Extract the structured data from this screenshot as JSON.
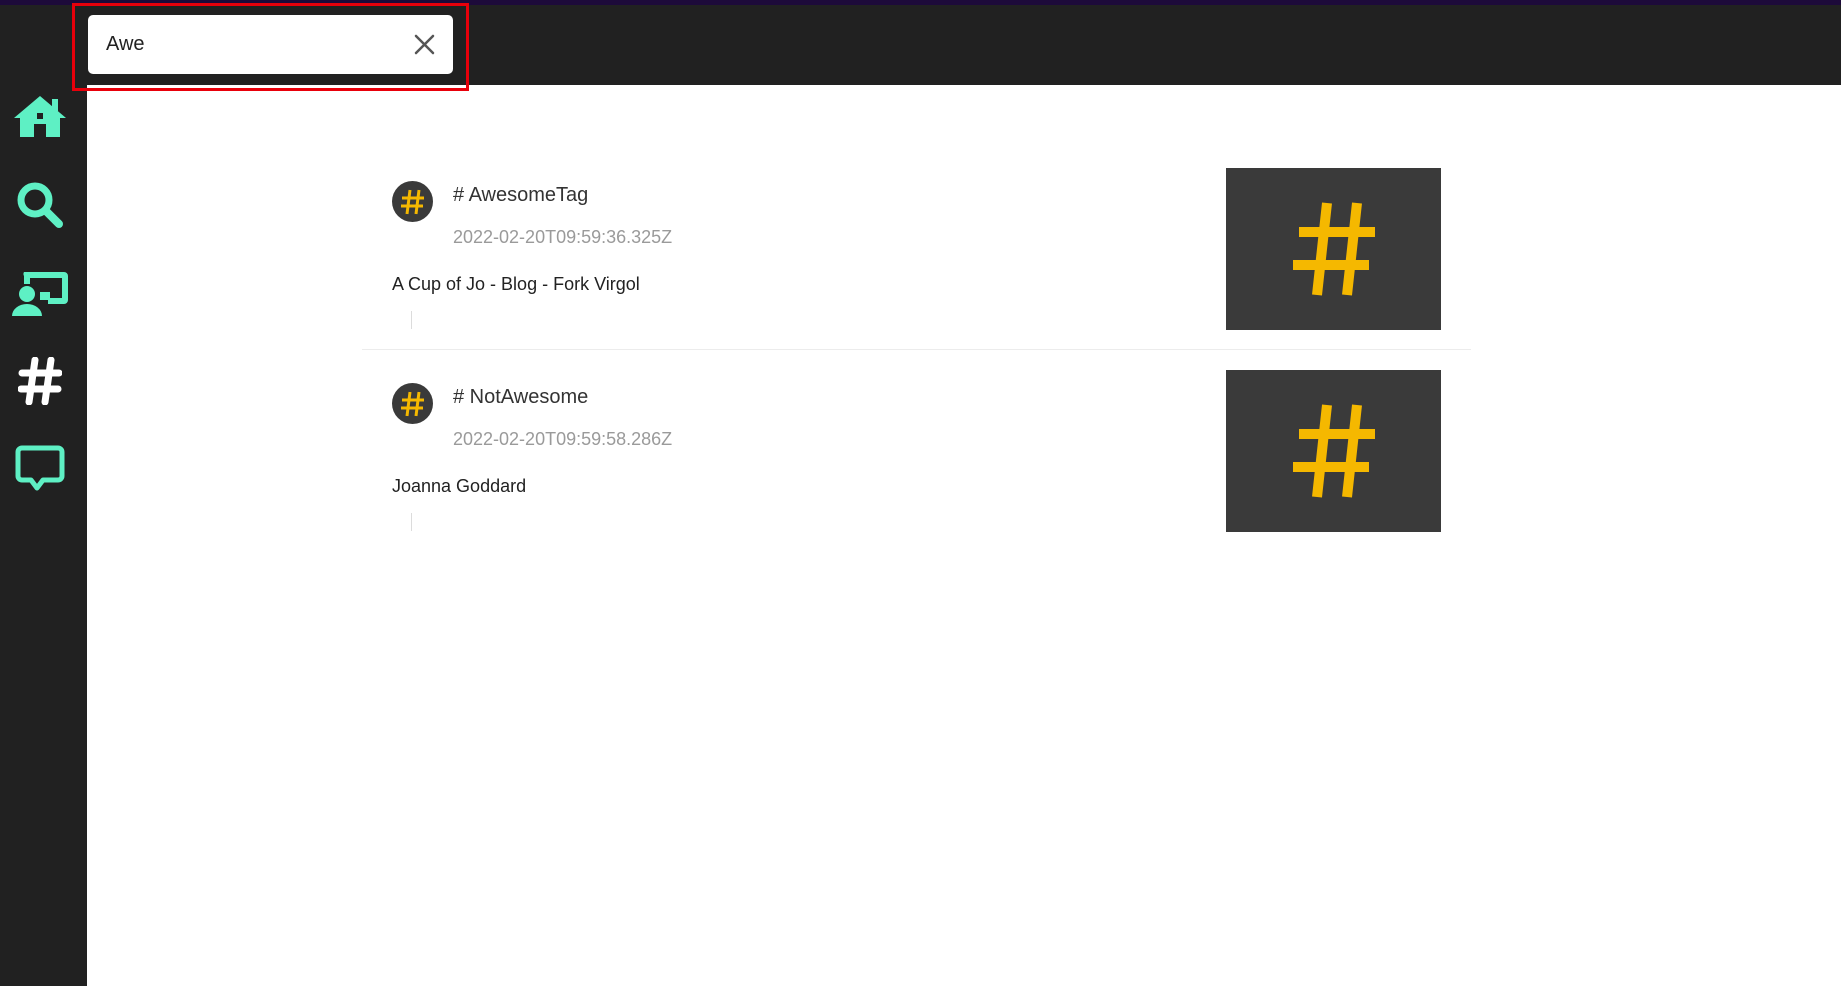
{
  "search": {
    "value": "Awe",
    "placeholder": ""
  },
  "sidebar": {
    "items": [
      {
        "name": "home",
        "icon": "home-icon"
      },
      {
        "name": "search",
        "icon": "search-icon"
      },
      {
        "name": "presenter",
        "icon": "user-screen-icon"
      },
      {
        "name": "tags",
        "icon": "hashtag-icon"
      },
      {
        "name": "messages",
        "icon": "chat-bubble-icon"
      }
    ]
  },
  "results": [
    {
      "title": "# AwesomeTag",
      "date": "2022-02-20T09:59:36.325Z",
      "description": "A Cup of Jo - Blog - Fork Virgol"
    },
    {
      "title": "# NotAwesome",
      "date": "2022-02-20T09:59:58.286Z",
      "description": "Joanna Goddard"
    }
  ],
  "colors": {
    "accent": "#5ef0c4",
    "sidebar_bg": "#212121",
    "hashtag": "#f5b800",
    "thumb_bg": "#3a3a3a",
    "highlight": "#e8000b"
  }
}
